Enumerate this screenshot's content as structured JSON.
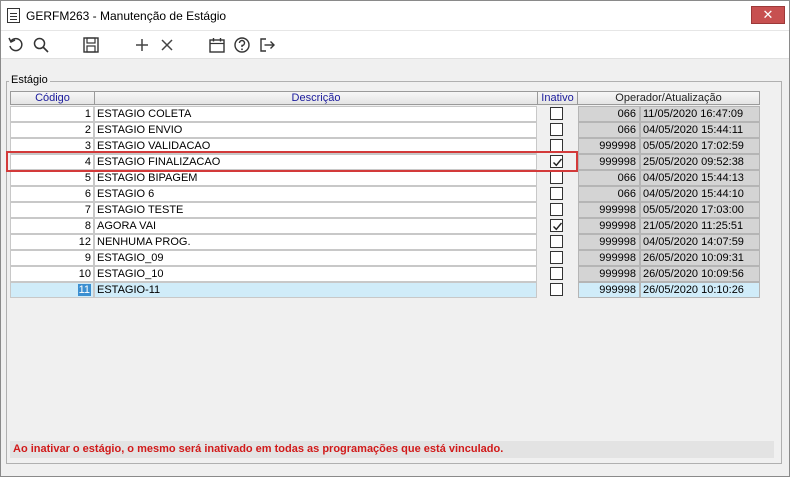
{
  "window": {
    "title": "GERFM263 - Manutenção de Estágio",
    "close_label": "✕"
  },
  "toolbar": {
    "icons": [
      "refresh-icon",
      "search-icon",
      "save-icon",
      "add-icon",
      "delete-icon",
      "calendar-icon",
      "help-icon",
      "exit-icon"
    ]
  },
  "group": {
    "title": "Estágio"
  },
  "grid": {
    "headers": {
      "code": "Código",
      "description": "Descrição",
      "inactive": "Inativo",
      "operator": "Operador/Atualização"
    },
    "rows": [
      {
        "code": "1",
        "description": "ESTAGIO COLETA",
        "inactive": false,
        "operator": "066",
        "updated": "11/05/2020 16:47:09"
      },
      {
        "code": "2",
        "description": "ESTAGIO ENVIO",
        "inactive": false,
        "operator": "066",
        "updated": "04/05/2020 15:44:11"
      },
      {
        "code": "3",
        "description": "ESTAGIO VALIDACAO",
        "inactive": false,
        "operator": "999998",
        "updated": "05/05/2020 17:02:59"
      },
      {
        "code": "4",
        "description": "ESTAGIO FINALIZACAO",
        "inactive": true,
        "operator": "999998",
        "updated": "25/05/2020 09:52:38"
      },
      {
        "code": "5",
        "description": "ESTAGIO BIPAGEM",
        "inactive": false,
        "operator": "066",
        "updated": "04/05/2020 15:44:13"
      },
      {
        "code": "6",
        "description": "ESTAGIO 6",
        "inactive": false,
        "operator": "066",
        "updated": "04/05/2020 15:44:10"
      },
      {
        "code": "7",
        "description": "ESTAGIO TESTE",
        "inactive": false,
        "operator": "999998",
        "updated": "05/05/2020 17:03:00"
      },
      {
        "code": "8",
        "description": "AGORA VAI",
        "inactive": true,
        "operator": "999998",
        "updated": "21/05/2020 11:25:51"
      },
      {
        "code": "12",
        "description": "NENHUMA PROG.",
        "inactive": false,
        "operator": "999998",
        "updated": "04/05/2020 14:07:59"
      },
      {
        "code": "9",
        "description": "ESTAGIO_09",
        "inactive": false,
        "operator": "999998",
        "updated": "26/05/2020 10:09:31"
      },
      {
        "code": "10",
        "description": "ESTAGIO_10",
        "inactive": false,
        "operator": "999998",
        "updated": "26/05/2020 10:09:56"
      },
      {
        "code": "11",
        "description": "ESTAGIO-11",
        "inactive": false,
        "operator": "999998",
        "updated": "26/05/2020 10:10:26"
      }
    ],
    "selected_row": 11,
    "highlighted_row": 3
  },
  "footer": {
    "message": "Ao inativar o estágio, o mesmo será inativado em todas as programações que está vinculado."
  },
  "colors": {
    "highlight": "#d33a3a",
    "selection": "#d0ecf9",
    "message": "#d11a1a"
  }
}
